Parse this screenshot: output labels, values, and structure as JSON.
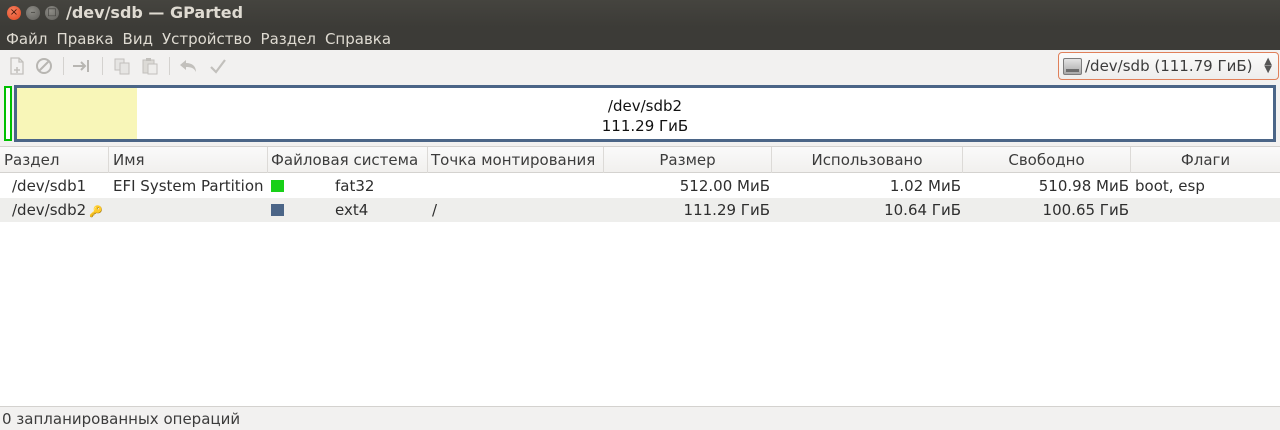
{
  "window": {
    "title": "/dev/sdb — GParted",
    "close_glyph": "×",
    "minimize_glyph": "–",
    "maximize_glyph": "□"
  },
  "menu": [
    "Файл",
    "Правка",
    "Вид",
    "Устройство",
    "Раздел",
    "Справка"
  ],
  "toolbar": {
    "icons": [
      "new-partition-icon",
      "delete-partition-icon",
      "resize-move-icon",
      "copy-icon",
      "paste-icon",
      "undo-icon",
      "apply-icon"
    ]
  },
  "device_selector": {
    "value": "/dev/sdb  (111.79 ГиБ)",
    "arrow_up": "▲",
    "arrow_down": "▼"
  },
  "disk_map": {
    "partition_name": "/dev/sdb2",
    "partition_size": "111.29 ГиБ",
    "used_fraction": 0.0956,
    "colors": {
      "fat32": "#18d018",
      "ext4": "#4b6587",
      "used": "#f8f6b8"
    }
  },
  "table": {
    "headers": [
      "Раздел",
      "Имя",
      "Файловая система",
      "Точка монтирования",
      "Размер",
      "Использовано",
      "Свободно",
      "Флаги"
    ],
    "rows": [
      {
        "partition": "/dev/sdb1",
        "name": "EFI System Partition",
        "fs": "fat32",
        "fs_color": "#18d018",
        "mount": "",
        "size": "512.00 МиБ",
        "used": "1.02 МиБ",
        "free": "510.98 МиБ",
        "flags": "boot, esp",
        "mounted_key": ""
      },
      {
        "partition": "/dev/sdb2",
        "name": "",
        "fs": "ext4",
        "fs_color": "#4b6587",
        "mount": "/",
        "size": "111.29 ГиБ",
        "used": "10.64 ГиБ",
        "free": "100.65 ГиБ",
        "flags": "",
        "mounted_key": "🔑"
      }
    ]
  },
  "status": "0 запланированных операций"
}
